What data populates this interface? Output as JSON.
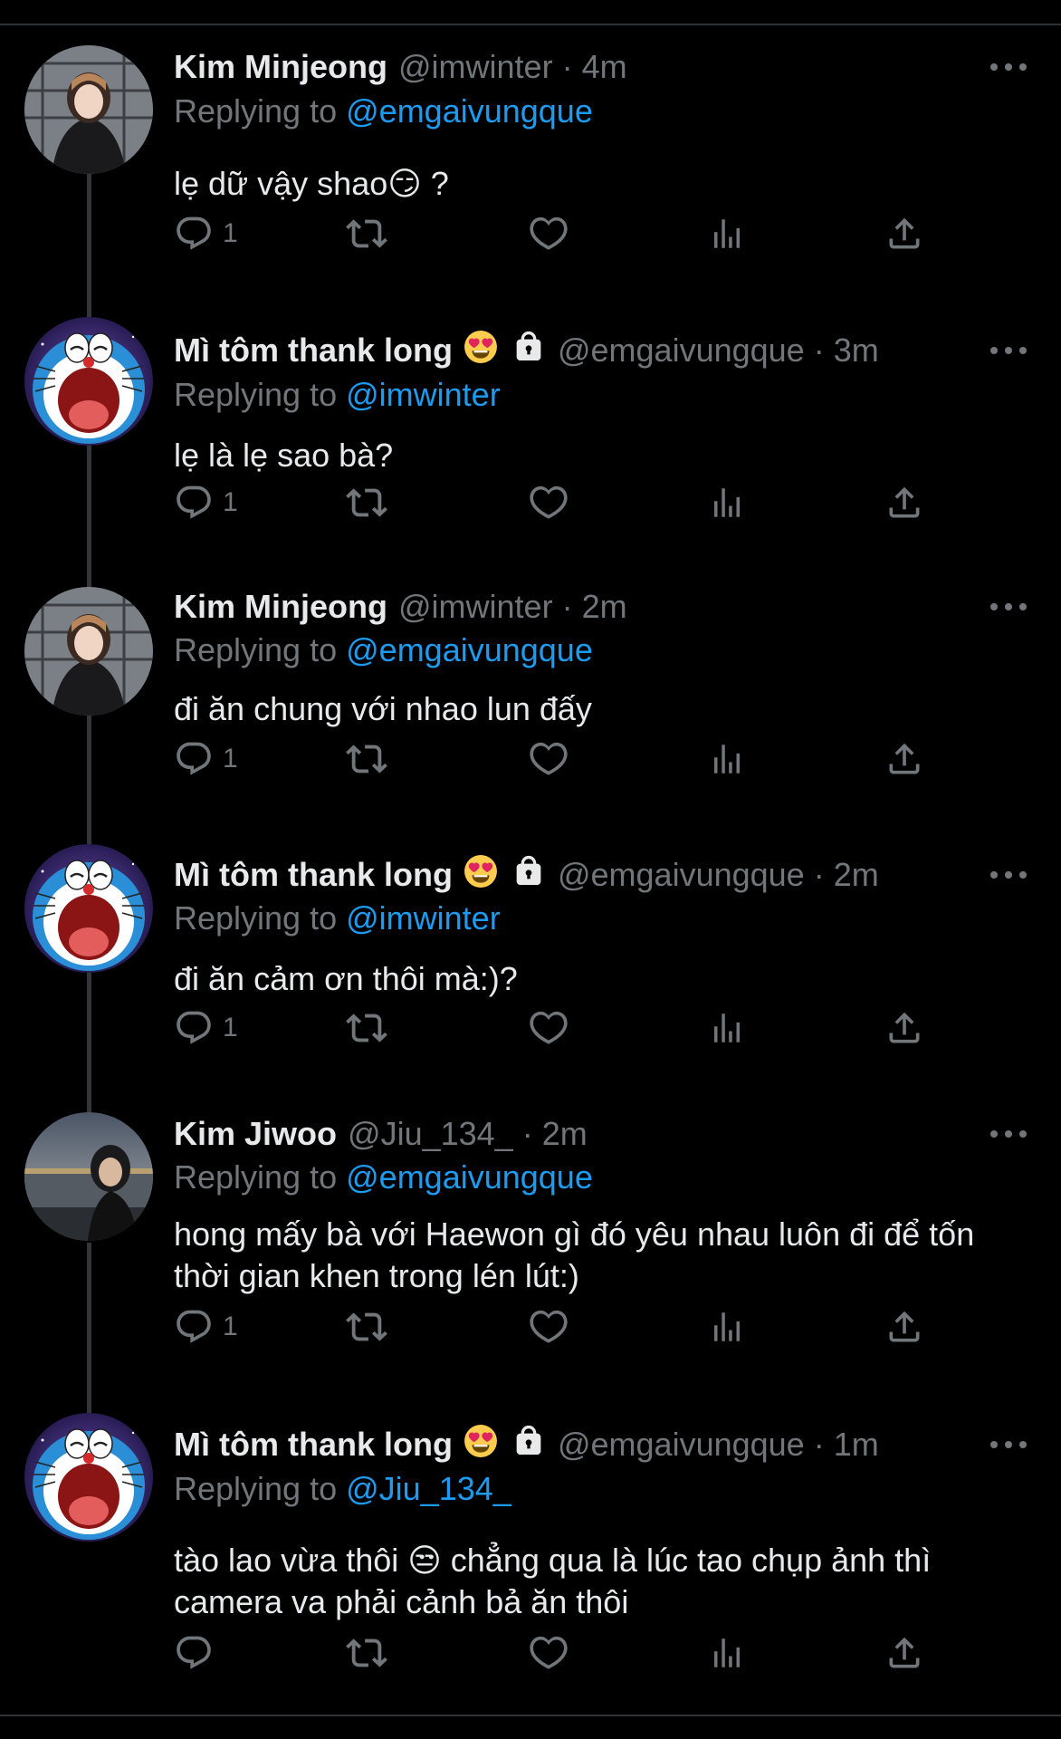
{
  "colors": {
    "background": "#000000",
    "text": "#e7e9ea",
    "muted": "#71767b",
    "link": "#1d9bf0"
  },
  "tweets": [
    {
      "name": "Kim Minjeong",
      "handle": "@imwinter",
      "time": "4m",
      "reply_prefix": "Replying to",
      "reply_to": "@emgaivungque",
      "text": "lẹ dữ vậy shao😏 ?",
      "reply_count": "1",
      "avatar": "photo-girl-dark",
      "name_emoji": "",
      "locked": false
    },
    {
      "name": "Mì tôm thank long",
      "handle": "@emgaivungque",
      "time": "3m",
      "reply_prefix": "Replying to",
      "reply_to": "@imwinter",
      "text": "lẹ là lẹ sao bà?",
      "reply_count": "1",
      "avatar": "doraemon-crying",
      "name_emoji": "heart-eyes-emoji",
      "locked": true
    },
    {
      "name": "Kim Minjeong",
      "handle": "@imwinter",
      "time": "2m",
      "reply_prefix": "Replying to",
      "reply_to": "@emgaivungque",
      "text": "đi ăn chung với nhao lun đấy",
      "reply_count": "1",
      "avatar": "photo-girl-dark",
      "name_emoji": "",
      "locked": false
    },
    {
      "name": "Mì tôm thank long",
      "handle": "@emgaivungque",
      "time": "2m",
      "reply_prefix": "Replying to",
      "reply_to": "@imwinter",
      "text": "đi ăn cảm ơn thôi mà:)?",
      "reply_count": "1",
      "avatar": "doraemon-crying",
      "name_emoji": "heart-eyes-emoji",
      "locked": true
    },
    {
      "name": "Kim Jiwoo",
      "handle": "@Jiu_134_",
      "time": "2m",
      "reply_prefix": "Replying to",
      "reply_to": "@emgaivungque",
      "text": "hong mấy bà với Haewon gì đó yêu nhau luôn đi để tốn thời gian khen trong lén lút:)",
      "reply_count": "1",
      "avatar": "photo-night-city",
      "name_emoji": "",
      "locked": false
    },
    {
      "name": "Mì tôm thank long",
      "handle": "@emgaivungque",
      "time": "1m",
      "reply_prefix": "Replying to",
      "reply_to": "@Jiu_134_",
      "text": "tào lao vừa thôi 😒 chẳng qua là lúc tao chụp ảnh thì camera va phải cảnh bả ăn thôi",
      "reply_count": "",
      "avatar": "doraemon-crying",
      "name_emoji": "heart-eyes-emoji",
      "locked": true
    }
  ],
  "icons": [
    "reply-icon",
    "retweet-icon",
    "like-icon",
    "analytics-icon",
    "share-icon",
    "more-icon"
  ]
}
